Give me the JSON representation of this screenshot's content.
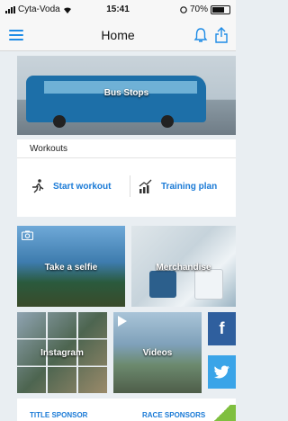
{
  "status_bar": {
    "carrier": "Cyta-Voda",
    "time": "15:41",
    "battery": "70%"
  },
  "nav": {
    "title": "Home"
  },
  "banner": {
    "label": "Bus Stops"
  },
  "workouts": {
    "header": "Workouts",
    "start_label": "Start workout",
    "plan_label": "Training plan"
  },
  "tiles": {
    "selfie": "Take a selfie",
    "merch": "Merchandise",
    "instagram": "Instagram",
    "videos": "Videos"
  },
  "sponsors": {
    "title_sponsor": "TITLE SPONSOR",
    "race_sponsors": "RACE SPONSORS"
  },
  "colors": {
    "accent": "#1a7ad6",
    "facebook": "#2f5f9e",
    "twitter": "#3aa4e8"
  }
}
